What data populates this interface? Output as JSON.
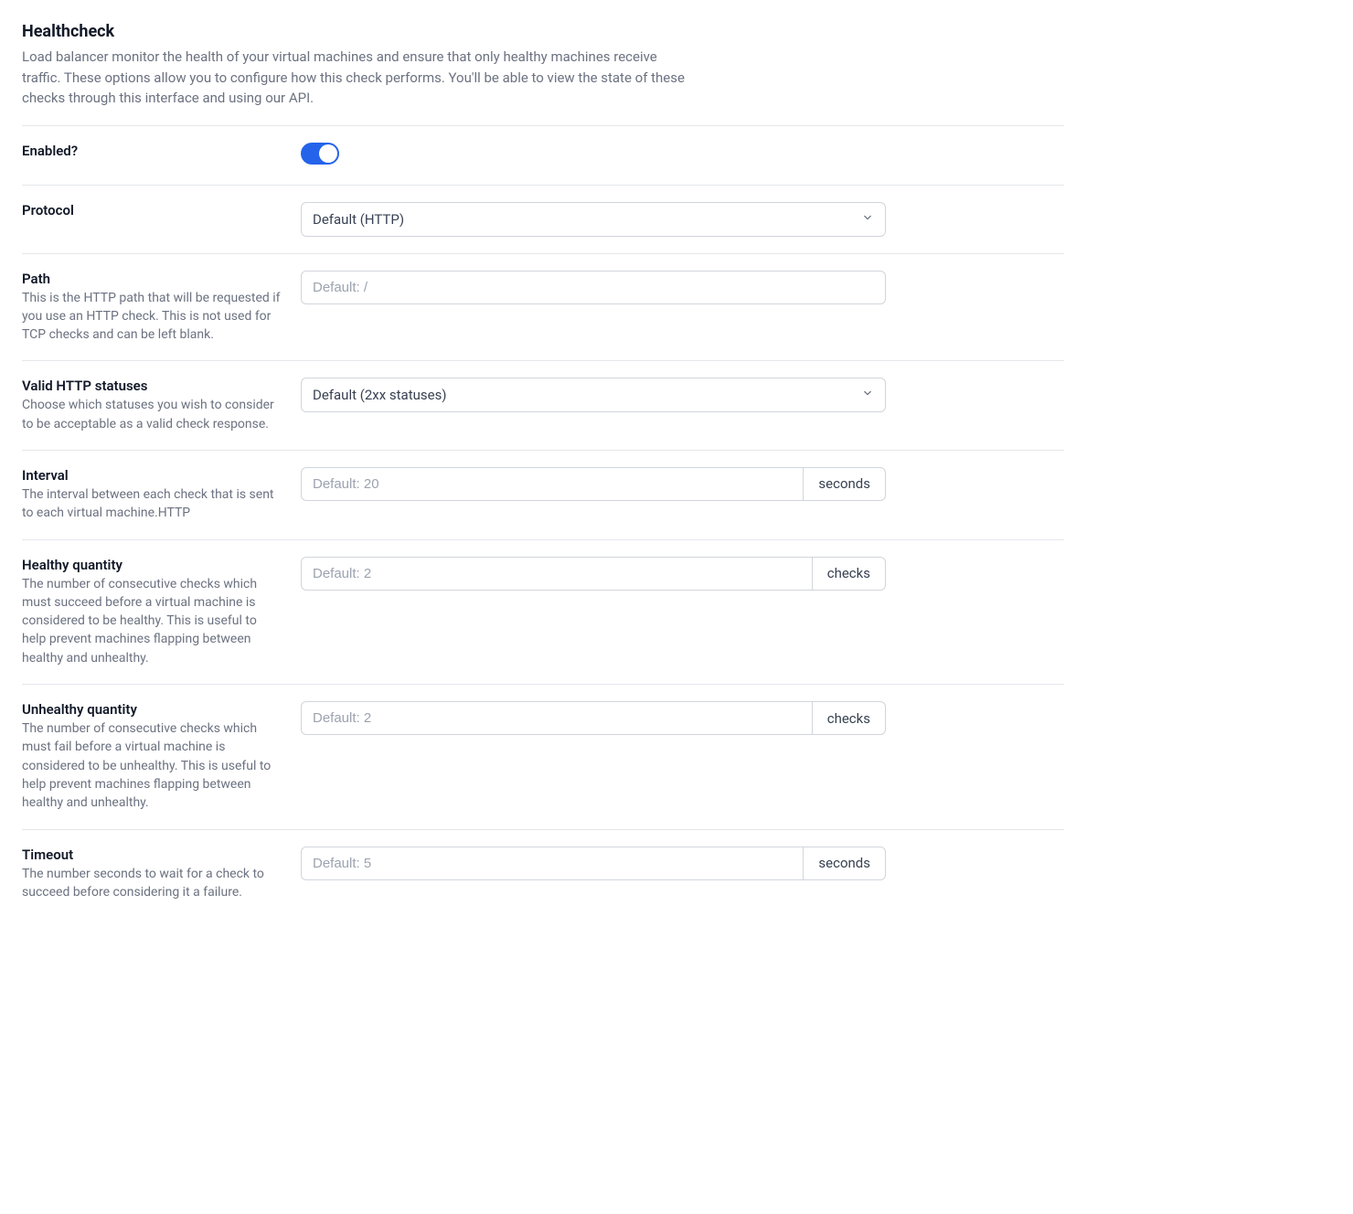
{
  "section": {
    "title": "Healthcheck",
    "description": "Load balancer monitor the health of your virtual machines and ensure that only healthy machines receive traffic. These options allow you to configure how this check performs. You'll be able to view the state of these checks through this interface and using our API."
  },
  "enabled": {
    "label": "Enabled?",
    "value": true
  },
  "protocol": {
    "label": "Protocol",
    "selected": "Default (HTTP)"
  },
  "path": {
    "label": "Path",
    "description": "This is the HTTP path that will be requested if you use an HTTP check. This is not used for TCP checks and can be left blank.",
    "placeholder": "Default: /",
    "value": ""
  },
  "validStatuses": {
    "label": "Valid HTTP statuses",
    "description": "Choose which statuses you wish to consider to be acceptable as a valid check response.",
    "selected": "Default (2xx statuses)"
  },
  "interval": {
    "label": "Interval",
    "description": "The interval between each check that is sent to each virtual machine.HTTP",
    "placeholder": "Default: 20",
    "value": "",
    "unit": "seconds"
  },
  "healthyQuantity": {
    "label": "Healthy quantity",
    "description": "The number of consecutive checks which must succeed before a virtual machine is considered to be healthy. This is useful to help prevent machines flapping between healthy and unhealthy.",
    "placeholder": "Default: 2",
    "value": "",
    "unit": "checks"
  },
  "unhealthyQuantity": {
    "label": "Unhealthy quantity",
    "description": "The number of consecutive checks which must fail before a virtual machine is considered to be unhealthy. This is useful to help prevent machines flapping between healthy and unhealthy.",
    "placeholder": "Default: 2",
    "value": "",
    "unit": "checks"
  },
  "timeout": {
    "label": "Timeout",
    "description": "The number seconds to wait for a check to succeed before considering it a failure.",
    "placeholder": "Default: 5",
    "value": "",
    "unit": "seconds"
  }
}
